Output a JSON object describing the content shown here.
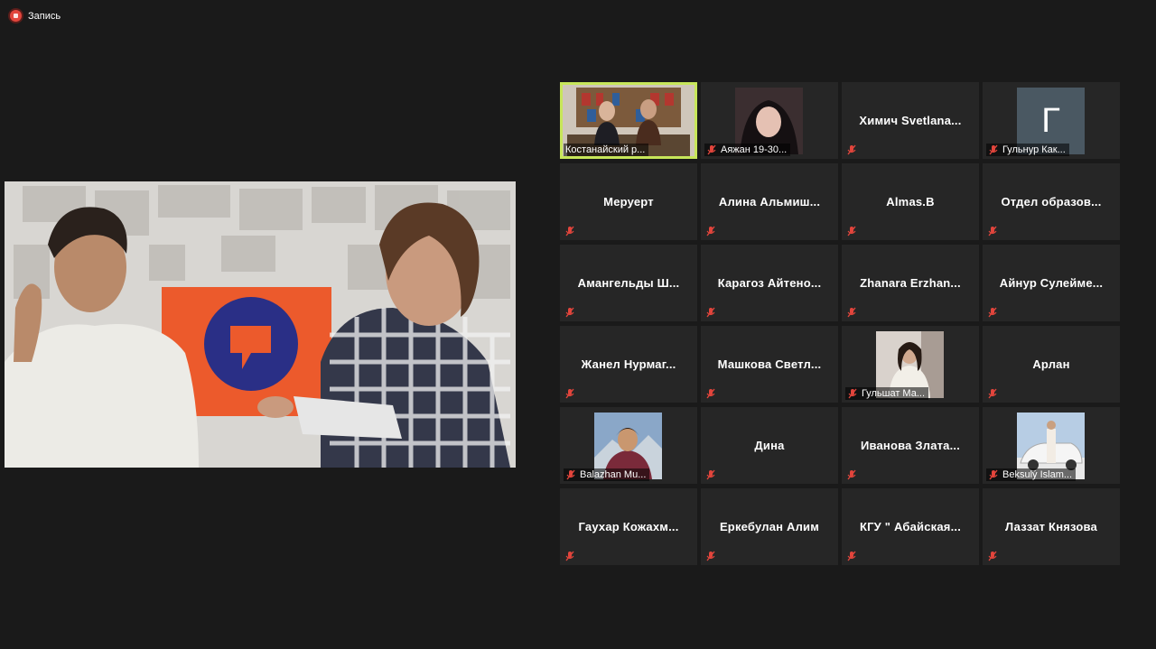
{
  "recording": {
    "label": "Запись"
  },
  "participants": [
    {
      "name": "Костанайский р...",
      "mode": "video",
      "active": true
    },
    {
      "name": "Аяжан 19-30...",
      "mode": "photo"
    },
    {
      "name": "Химич Svetlana...",
      "mode": "name"
    },
    {
      "name": "Гульнур Как...",
      "mode": "letter",
      "letter": "Г"
    },
    {
      "name": "Меруерт",
      "mode": "name"
    },
    {
      "name": "Алина Альмиш...",
      "mode": "name"
    },
    {
      "name": "Almas.B",
      "mode": "name"
    },
    {
      "name": "Отдел образов...",
      "mode": "name"
    },
    {
      "name": "Амангельды Ш...",
      "mode": "name"
    },
    {
      "name": "Карагоз Айтено...",
      "mode": "name"
    },
    {
      "name": "Zhanara Erzhan...",
      "mode": "name"
    },
    {
      "name": "Айнур Сулейме...",
      "mode": "name"
    },
    {
      "name": "Жанел Нурмаг...",
      "mode": "name"
    },
    {
      "name": "Машкова Светл...",
      "mode": "name"
    },
    {
      "name": "Гульшат Ма...",
      "mode": "photo"
    },
    {
      "name": "Арлан",
      "mode": "name"
    },
    {
      "name": "Balazhan Mu...",
      "mode": "photo"
    },
    {
      "name": "Дина",
      "mode": "name"
    },
    {
      "name": "Иванова Злата...",
      "mode": "name"
    },
    {
      "name": "Beksulý Islam...",
      "mode": "photo"
    },
    {
      "name": "Гаухар Кожахм...",
      "mode": "name"
    },
    {
      "name": "Еркебулан Алим",
      "mode": "name"
    },
    {
      "name": "КГУ \" Абайская...",
      "mode": "name"
    },
    {
      "name": "Лаззат Князова",
      "mode": "name"
    }
  ],
  "colors": {
    "background": "#1a1a1a",
    "tile": "#262626",
    "active_outline": "#c7e65a",
    "mute": "#e2453c"
  }
}
